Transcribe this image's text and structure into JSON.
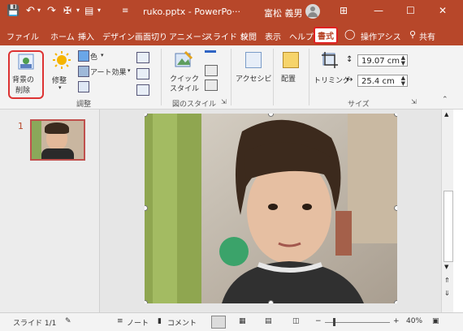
{
  "titlebar": {
    "filename": "ruko.pptx  -  PowerPo···",
    "user": "富松 義男",
    "min": "—",
    "max": "☐",
    "close": "✕",
    "ribbon_opts": "⊞"
  },
  "tabs": [
    "ファイル",
    "ホーム",
    "挿入",
    "デザイン",
    "画面切り",
    "アニメーシ",
    "スライド シ",
    "校閲",
    "表示",
    "ヘルプ"
  ],
  "active_tab": "書式",
  "tell_me": "操作アシス",
  "share": "共有",
  "ribbon": {
    "remove_bg_line1": "背景の",
    "remove_bg_line2": "削除",
    "corrections": "修整",
    "color": "色",
    "artistic": "アート効果",
    "group_adjust": "調整",
    "quick_styles_1": "クイック",
    "quick_styles_2": "スタイル",
    "group_styles": "図のスタイル",
    "accessibility": "アクセシビ",
    "arrange": "配置",
    "crop": "トリミング",
    "height": "19.07 cm",
    "width": "25.4 cm",
    "group_size": "サイズ"
  },
  "slide_number": "1",
  "status": {
    "slide": "スライド 1/1",
    "notes": "ノート",
    "comments": "コメント",
    "zoom": "40%"
  },
  "colors": {
    "accent": "#b7472a",
    "highlight": "#e02020"
  }
}
